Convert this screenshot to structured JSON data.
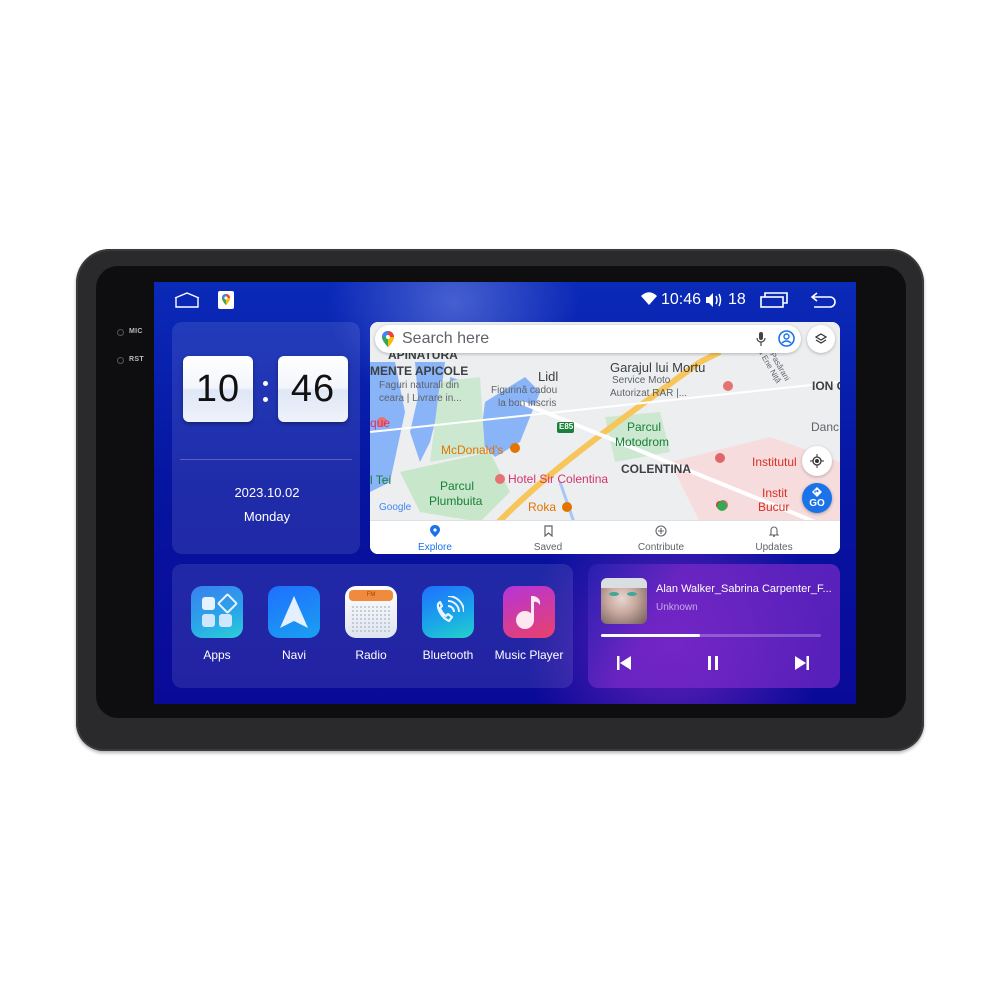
{
  "device": {
    "mic_label": "MIC",
    "rst_label": "RST"
  },
  "statusbar": {
    "home_icon": "home-icon",
    "maps_icon": "google-maps-icon",
    "wifi_icon": "wifi-icon",
    "time": "10:46",
    "volume_icon": "volume-icon",
    "volume_level": "18",
    "recents_icon": "recent-apps-icon",
    "back_icon": "back-icon"
  },
  "clock_widget": {
    "hours": "10",
    "minutes": "46",
    "date": "2023.10.02",
    "weekday": "Monday"
  },
  "map_widget": {
    "search_placeholder": "Search here",
    "labels": [
      {
        "text": "APINATURA",
        "color": "#3c4043"
      },
      {
        "text": "MENTE APICOLE",
        "color": "#3c4043"
      },
      {
        "text": "Faguri naturali din",
        "color": "#5f6368"
      },
      {
        "text": "ceara | Livrare in...",
        "color": "#5f6368"
      },
      {
        "text": "Lidl",
        "color": "#3c4043"
      },
      {
        "text": "Figurină cadou",
        "color": "#5f6368"
      },
      {
        "text": "la bon inscris",
        "color": "#5f6368"
      },
      {
        "text": "Garajul lui Mortu",
        "color": "#3c4043"
      },
      {
        "text": "Service Moto",
        "color": "#5f6368"
      },
      {
        "text": "Autorizat RAR |...",
        "color": "#5f6368"
      },
      {
        "text": "ION C",
        "color": "#3c4043"
      },
      {
        "text": "Danc",
        "color": "#5f6368"
      },
      {
        "text": "que",
        "color": "#d6336c"
      },
      {
        "text": "McDonald's",
        "color": "#e37400"
      },
      {
        "text": "Parcul",
        "color": "#188038"
      },
      {
        "text": "Motodrom",
        "color": "#188038"
      },
      {
        "text": "E85",
        "color": "#ffffff"
      },
      {
        "text": "COLENTINA",
        "color": "#3c4043"
      },
      {
        "text": "Institutul",
        "color": "#d93025"
      },
      {
        "text": "l Tei",
        "color": "#188038"
      },
      {
        "text": "Hotel Sir Colentina",
        "color": "#d6336c"
      },
      {
        "text": "Parcul",
        "color": "#188038"
      },
      {
        "text": "Plumbuita",
        "color": "#188038"
      },
      {
        "text": "Roka",
        "color": "#e37400"
      },
      {
        "text": "Instit",
        "color": "#d93025"
      },
      {
        "text": "Bucur",
        "color": "#d93025"
      },
      {
        "text": "Pasărani",
        "color": "#5f6368"
      },
      {
        "text": "Ja Ene Niță",
        "color": "#5f6368"
      },
      {
        "text": "Google",
        "color": "#4285f4"
      }
    ],
    "go_label": "GO",
    "nav_tabs": [
      {
        "label": "Explore",
        "icon": "location-pin-icon",
        "active": true
      },
      {
        "label": "Saved",
        "icon": "bookmark-icon",
        "active": false
      },
      {
        "label": "Contribute",
        "icon": "add-circle-icon",
        "active": false
      },
      {
        "label": "Updates",
        "icon": "bell-icon",
        "active": false
      }
    ],
    "accent_color": "#1a73e8"
  },
  "apps": [
    {
      "label": "Apps",
      "icon": "apps-grid-icon"
    },
    {
      "label": "Navi",
      "icon": "navigation-arrow-icon"
    },
    {
      "label": "Radio",
      "icon": "radio-fm-icon",
      "badge": "FM"
    },
    {
      "label": "Bluetooth",
      "icon": "bluetooth-phone-icon"
    },
    {
      "label": "Music Player",
      "icon": "music-note-icon"
    }
  ],
  "music_widget": {
    "title": "Alan Walker_Sabrina Carpenter_F...",
    "artist": "Unknown",
    "progress": 0.45,
    "prev_icon": "skip-previous-icon",
    "pause_icon": "pause-icon",
    "next_icon": "skip-next-icon"
  }
}
